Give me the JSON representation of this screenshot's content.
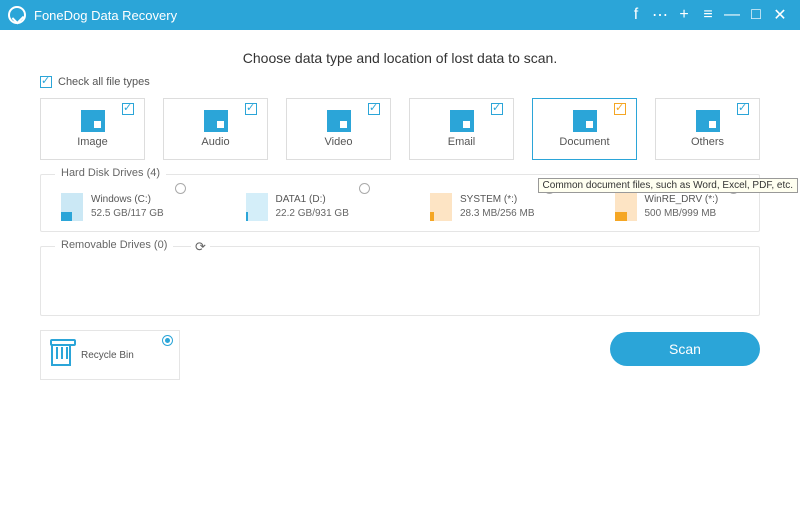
{
  "titlebar": {
    "title": "FoneDog Data Recovery"
  },
  "heading": "Choose data type and location of lost data to scan.",
  "checkall_label": "Check all file types",
  "types": [
    {
      "label": "Image"
    },
    {
      "label": "Audio"
    },
    {
      "label": "Video"
    },
    {
      "label": "Email"
    },
    {
      "label": "Document"
    },
    {
      "label": "Others"
    }
  ],
  "sections": {
    "hdd_title": "Hard Disk Drives (4)",
    "removable_title": "Removable Drives (0)"
  },
  "drives": [
    {
      "name": "Windows (C:)",
      "size": "52.5 GB/117 GB"
    },
    {
      "name": "DATA1 (D:)",
      "size": "22.2 GB/931 GB"
    },
    {
      "name": "SYSTEM (*:)",
      "size": "28.3 MB/256 MB"
    },
    {
      "name": "WinRE_DRV (*:)",
      "size": "500 MB/999 MB"
    }
  ],
  "recycle_label": "Recycle Bin",
  "tooltip": "Common document files, such as Word, Excel, PDF, etc.",
  "scan_label": "Scan"
}
